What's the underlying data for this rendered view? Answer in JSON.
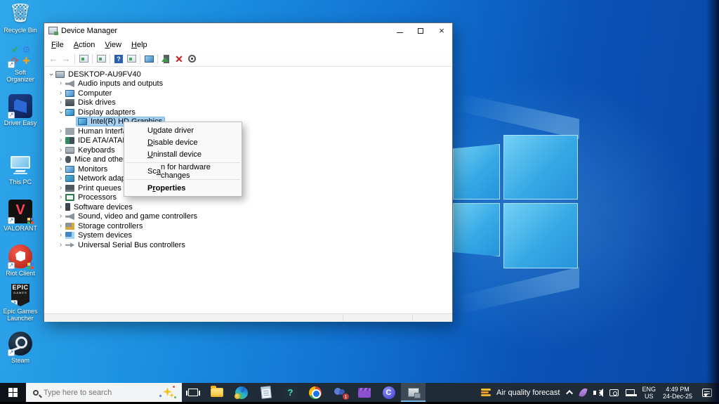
{
  "colors": {
    "accent": "#0078d7",
    "taskbar_bg": "#1f2b37",
    "selection_bg": "#a6d1f2",
    "wallpaper_light": "#2fa7ea",
    "wallpaper_dark": "#0846a6",
    "teams_badge_bg": "#c43b3b"
  },
  "window": {
    "title": "Device Manager",
    "menus": [
      {
        "pre": "",
        "key": "F",
        "post": "ile"
      },
      {
        "pre": "",
        "key": "A",
        "post": "ction"
      },
      {
        "pre": "",
        "key": "V",
        "post": "iew"
      },
      {
        "pre": "",
        "key": "H",
        "post": "elp"
      }
    ],
    "tree": [
      {
        "label": "DESKTOP-AU9FV40"
      },
      {
        "label": "Audio inputs and outputs"
      },
      {
        "label": "Computer"
      },
      {
        "label": "Disk drives"
      },
      {
        "label": "Display adapters"
      },
      {
        "label": "Intel(R) HD Graphics"
      },
      {
        "label": "Human Interface Devices"
      },
      {
        "label": "IDE ATA/ATAPI controllers"
      },
      {
        "label": "Keyboards"
      },
      {
        "label": "Mice and other pointing devices"
      },
      {
        "label": "Monitors"
      },
      {
        "label": "Network adapters"
      },
      {
        "label": "Print queues"
      },
      {
        "label": "Processors"
      },
      {
        "label": "Software devices"
      },
      {
        "label": "Sound, video and game controllers"
      },
      {
        "label": "Storage controllers"
      },
      {
        "label": "System devices"
      },
      {
        "label": "Universal Serial Bus controllers"
      }
    ]
  },
  "context_menu": {
    "items": [
      {
        "pre": "U",
        "key": "p",
        "post": "date driver"
      },
      {
        "pre": "",
        "key": "D",
        "post": "isable device"
      },
      {
        "pre": "",
        "key": "U",
        "post": "ninstall device"
      },
      {
        "pre": "Sc",
        "key": "a",
        "post": "n for hardware changes"
      },
      {
        "pre": "P",
        "key": "r",
        "post": "operties"
      }
    ]
  },
  "desktop": {
    "icons": [
      {
        "label": "Recycle Bin"
      },
      {
        "label": "Soft Organizer"
      },
      {
        "label": "Driver Easy"
      },
      {
        "label": "This PC"
      },
      {
        "label": "VALORANT"
      },
      {
        "label": "Riot Client"
      },
      {
        "label": "Epic Games Launcher"
      },
      {
        "label": "Steam"
      }
    ],
    "epic_line1": "EPIC",
    "epic_line2": "GAMES"
  },
  "taskbar": {
    "search_placeholder": "Type here to search",
    "teams_badge": "1",
    "widget_label": "Air quality forecast",
    "language": {
      "line1": "ENG",
      "line2": "US"
    },
    "clock": {
      "time": "4:49 PM",
      "date": "24-Dec-25"
    }
  }
}
